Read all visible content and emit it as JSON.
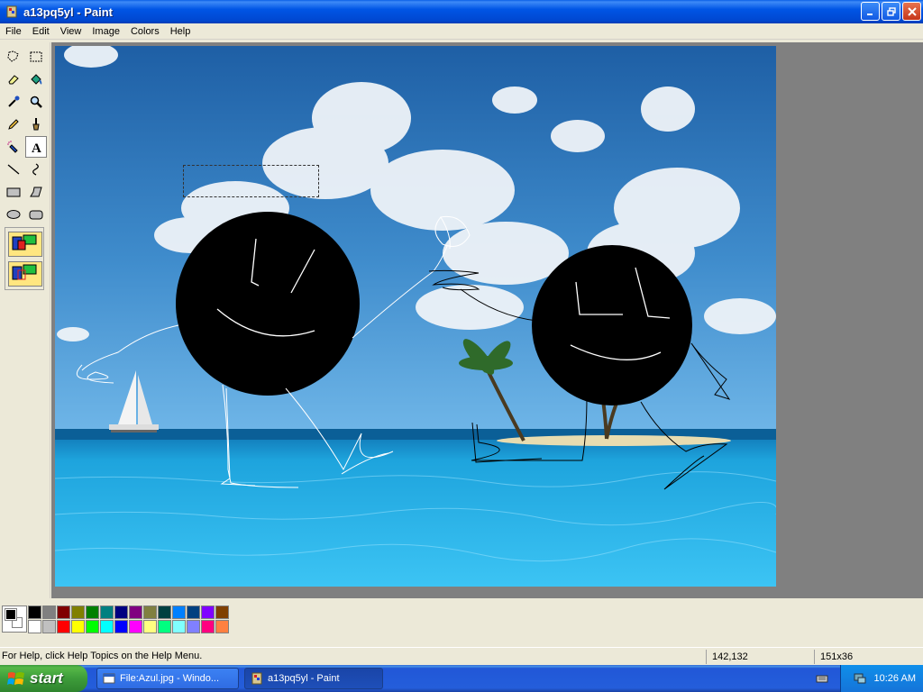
{
  "window": {
    "title": "a13pq5yl - Paint"
  },
  "menu": [
    "File",
    "Edit",
    "View",
    "Image",
    "Colors",
    "Help"
  ],
  "tools": [
    "free-form-select",
    "select",
    "eraser",
    "fill-with-color",
    "pick-color",
    "magnifier",
    "pencil",
    "brush",
    "airbrush",
    "text",
    "line",
    "curve",
    "rectangle",
    "polygon",
    "ellipse",
    "rounded-rectangle"
  ],
  "active_tool": "text",
  "palette": {
    "row1": [
      "#000000",
      "#808080",
      "#800000",
      "#808000",
      "#008000",
      "#008080",
      "#000080",
      "#800080",
      "#808040",
      "#004040",
      "#0080ff",
      "#004080",
      "#8000ff",
      "#804000"
    ],
    "row2": [
      "#ffffff",
      "#c0c0c0",
      "#ff0000",
      "#ffff00",
      "#00ff00",
      "#00ffff",
      "#0000ff",
      "#ff00ff",
      "#ffff80",
      "#00ff80",
      "#80ffff",
      "#8080ff",
      "#ff0080",
      "#ff8040"
    ],
    "foreground": "#000000",
    "background": "#ffffff"
  },
  "status": {
    "help": "For Help, click Help Topics on the Help Menu.",
    "coords": "142,132",
    "size": "151x36"
  },
  "taskbar": {
    "start": "start",
    "tasks": [
      {
        "label": "File:Azul.jpg - Windo...",
        "active": false
      },
      {
        "label": "a13pq5yl - Paint",
        "active": true
      }
    ],
    "clock": "10:26 AM"
  }
}
